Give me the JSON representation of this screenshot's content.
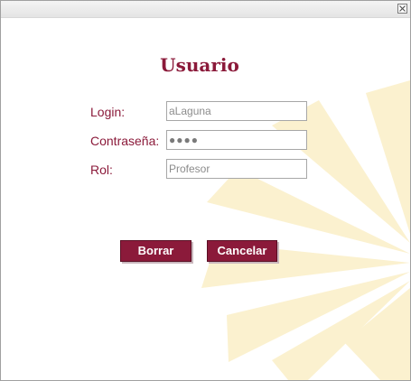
{
  "window": {
    "close_label": "×"
  },
  "form": {
    "title": "Usuario",
    "login": {
      "label": "Login:",
      "value": "aLaguna"
    },
    "password": {
      "label": "Contraseña:",
      "value": "●●●●"
    },
    "role": {
      "label": "Rol:",
      "value": "Profesor"
    }
  },
  "buttons": {
    "clear": "Borrar",
    "cancel": "Cancelar"
  },
  "colors": {
    "accent": "#8b1a3a",
    "watermark": "#fbf1cf"
  }
}
